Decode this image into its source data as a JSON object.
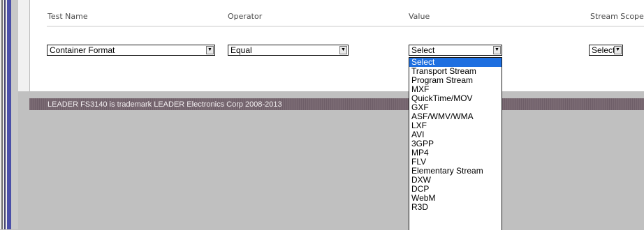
{
  "headers": {
    "test_name": "Test Name",
    "operator": "Operator",
    "value": "Value",
    "stream_scope": "Stream Scope"
  },
  "row": {
    "test_name_value": "Container Format",
    "operator_value": "Equal",
    "value_value": "Select",
    "stream_scope_value": "Select"
  },
  "dropdown": {
    "options": [
      "Select",
      "Transport Stream",
      "Program Stream",
      "MXF",
      "QuickTime/MOV",
      "GXF",
      "ASF/WMV/WMA",
      "LXF",
      "AVI",
      "3GPP",
      "MP4",
      "FLV",
      "Elementary Stream",
      "DXW",
      "DCP",
      "WebM",
      "R3D"
    ],
    "highlighted": "Select"
  },
  "footer": {
    "text": "LEADER FS3140 is trademark LEADER Electronics Corp 2008-2013"
  },
  "colors": {
    "highlight": "#1e6fe0",
    "footer_bg": "#74646e",
    "side_stripe": "#4a4fa8"
  }
}
